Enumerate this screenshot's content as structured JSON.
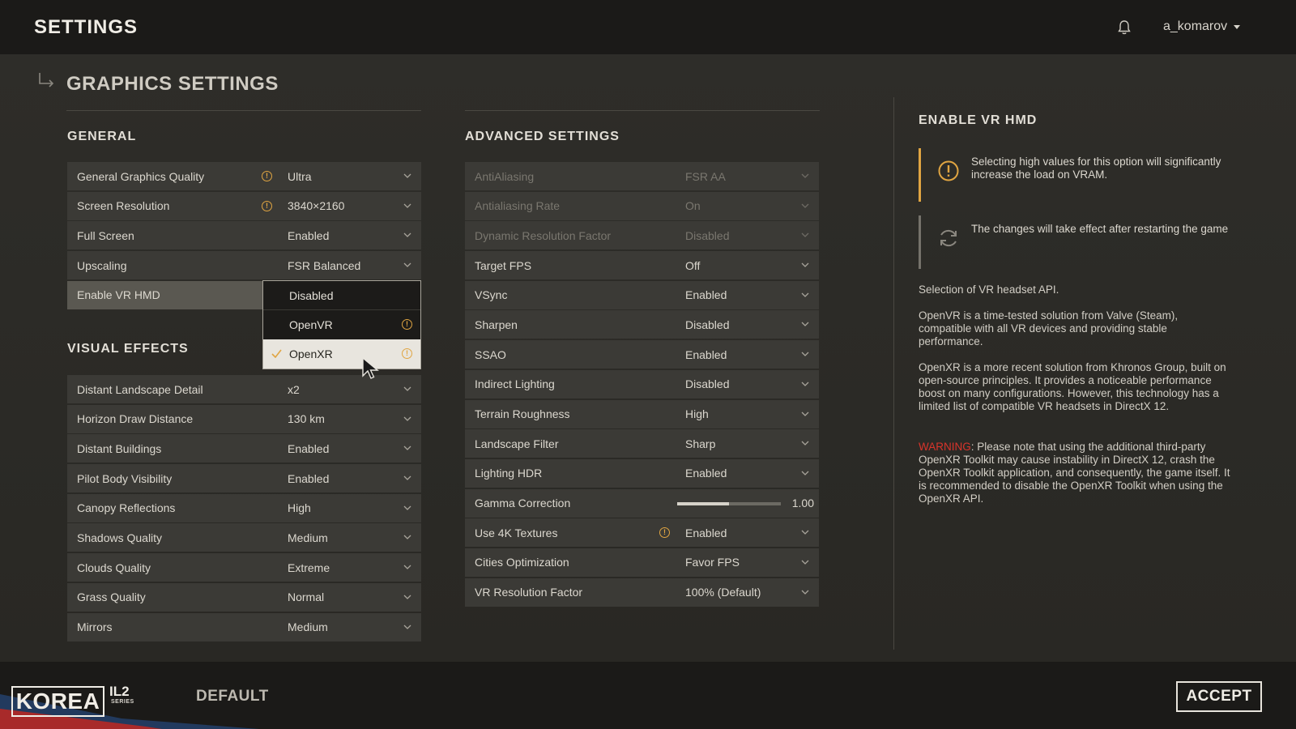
{
  "header": {
    "title": "SETTINGS",
    "username": "a_komarov"
  },
  "page": {
    "title": "GRAPHICS SETTINGS"
  },
  "general": {
    "title": "GENERAL",
    "rows": [
      {
        "label": "General Graphics Quality",
        "value": "Ultra",
        "info": true
      },
      {
        "label": "Screen Resolution",
        "value": "3840×2160",
        "info": true
      },
      {
        "label": "Full Screen",
        "value": "Enabled"
      },
      {
        "label": "Upscaling",
        "value": "FSR Balanced"
      },
      {
        "label": "Enable VR HMD",
        "value": "OpenXR",
        "highlight": true
      }
    ]
  },
  "vr_dropdown": {
    "options": [
      {
        "label": "Disabled",
        "info": false,
        "selected": false
      },
      {
        "label": "OpenVR",
        "info": true,
        "selected": false
      },
      {
        "label": "OpenXR",
        "info": true,
        "selected": true
      }
    ]
  },
  "visual": {
    "title": "VISUAL EFFECTS",
    "rows": [
      {
        "label": "Distant Landscape Detail",
        "value": "x2"
      },
      {
        "label": "Horizon Draw Distance",
        "value": "130 km"
      },
      {
        "label": "Distant Buildings",
        "value": "Enabled"
      },
      {
        "label": "Pilot Body Visibility",
        "value": "Enabled"
      },
      {
        "label": "Canopy Reflections",
        "value": "High"
      },
      {
        "label": "Shadows Quality",
        "value": "Medium"
      },
      {
        "label": "Clouds Quality",
        "value": "Extreme"
      },
      {
        "label": "Grass Quality",
        "value": "Normal"
      },
      {
        "label": "Mirrors",
        "value": "Medium"
      }
    ]
  },
  "advanced": {
    "title": "ADVANCED SETTINGS",
    "rows": [
      {
        "label": "AntiAliasing",
        "value": "FSR AA",
        "dim": true
      },
      {
        "label": "Antialiasing Rate",
        "value": "On",
        "dim": true
      },
      {
        "label": "Dynamic Resolution Factor",
        "value": "Disabled",
        "dim": true
      },
      {
        "label": "Target FPS",
        "value": "Off"
      },
      {
        "label": "VSync",
        "value": "Enabled"
      },
      {
        "label": "Sharpen",
        "value": "Disabled"
      },
      {
        "label": "SSAO",
        "value": "Enabled"
      },
      {
        "label": "Indirect Lighting",
        "value": "Disabled"
      },
      {
        "label": "Terrain Roughness",
        "value": "High"
      },
      {
        "label": "Landscape Filter",
        "value": "Sharp"
      },
      {
        "label": "Lighting HDR",
        "value": "Enabled"
      },
      {
        "label": "Gamma Correction",
        "value": "1.00",
        "slider": 0.5
      },
      {
        "label": "Use 4K Textures",
        "value": "Enabled",
        "info": true
      },
      {
        "label": "Cities Optimization",
        "value": "Favor FPS"
      },
      {
        "label": "VR Resolution Factor",
        "value": "100% (Default)"
      }
    ]
  },
  "help": {
    "title": "ENABLE VR HMD",
    "note_warning": "Selecting high values for this option will significantly increase the load on VRAM.",
    "note_restart": "The changes will take effect after restarting the game",
    "p1": "Selection of VR headset API.",
    "p2": "OpenVR is a time-tested solution from Valve (Steam), compatible with all VR devices and providing stable performance.",
    "p3": "OpenXR is a more recent solution from Khronos Group, built on open-source principles. It provides a noticeable performance boost on many configurations. However, this technology has a limited list of compatible VR headsets in DirectX 12.",
    "warning_word": "WARNING",
    "p4": ": Please note that using the additional third-party OpenXR Toolkit may cause instability in DirectX 12, crash the OpenXR Toolkit application, and consequently, the game itself. It is recommended to disable the OpenXR Toolkit when using the OpenXR API."
  },
  "footer": {
    "logo_text": "KOREA",
    "logo_il2": "IL2",
    "logo_series": "SERIES",
    "default_label": "DEFAULT",
    "accept_label": "ACCEPT"
  },
  "colors": {
    "accent_warning": "#e0a542",
    "warning_red": "#d8342b",
    "row_bg": "#3b3a36",
    "row_highlight": "#5a5851"
  }
}
